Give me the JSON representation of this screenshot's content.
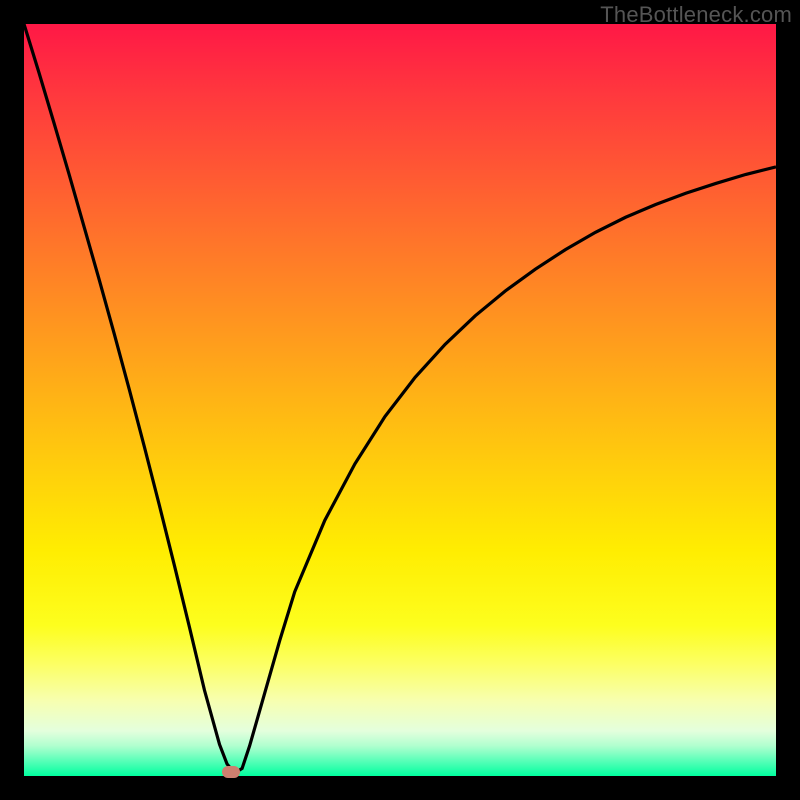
{
  "watermark": "TheBottleneck.com",
  "chart_data": {
    "type": "line",
    "title": "",
    "xlabel": "",
    "ylabel": "",
    "xlim": [
      0,
      100
    ],
    "ylim": [
      0,
      100
    ],
    "x": [
      0,
      2,
      4,
      6,
      8,
      10,
      12,
      14,
      16,
      18,
      20,
      22,
      24,
      26,
      27,
      28,
      29,
      30,
      32,
      34,
      36,
      40,
      44,
      48,
      52,
      56,
      60,
      64,
      68,
      72,
      76,
      80,
      84,
      88,
      92,
      96,
      100
    ],
    "values": [
      100,
      93.5,
      86.8,
      80.0,
      73.0,
      66.0,
      58.8,
      51.4,
      43.8,
      36.0,
      28.0,
      19.8,
      11.4,
      4.2,
      1.6,
      0.4,
      1.0,
      4.0,
      11.0,
      18.0,
      24.5,
      34.0,
      41.5,
      47.8,
      53.0,
      57.4,
      61.2,
      64.5,
      67.4,
      70.0,
      72.3,
      74.3,
      76.0,
      77.5,
      78.8,
      80.0,
      81.0
    ],
    "gradient_stops": [
      {
        "pos": 0,
        "color": "#ff1846"
      },
      {
        "pos": 50,
        "color": "#ffd10b"
      },
      {
        "pos": 100,
        "color": "#01ff9f"
      }
    ],
    "optimal_point": {
      "x": 27.5,
      "y": 0.5
    }
  }
}
